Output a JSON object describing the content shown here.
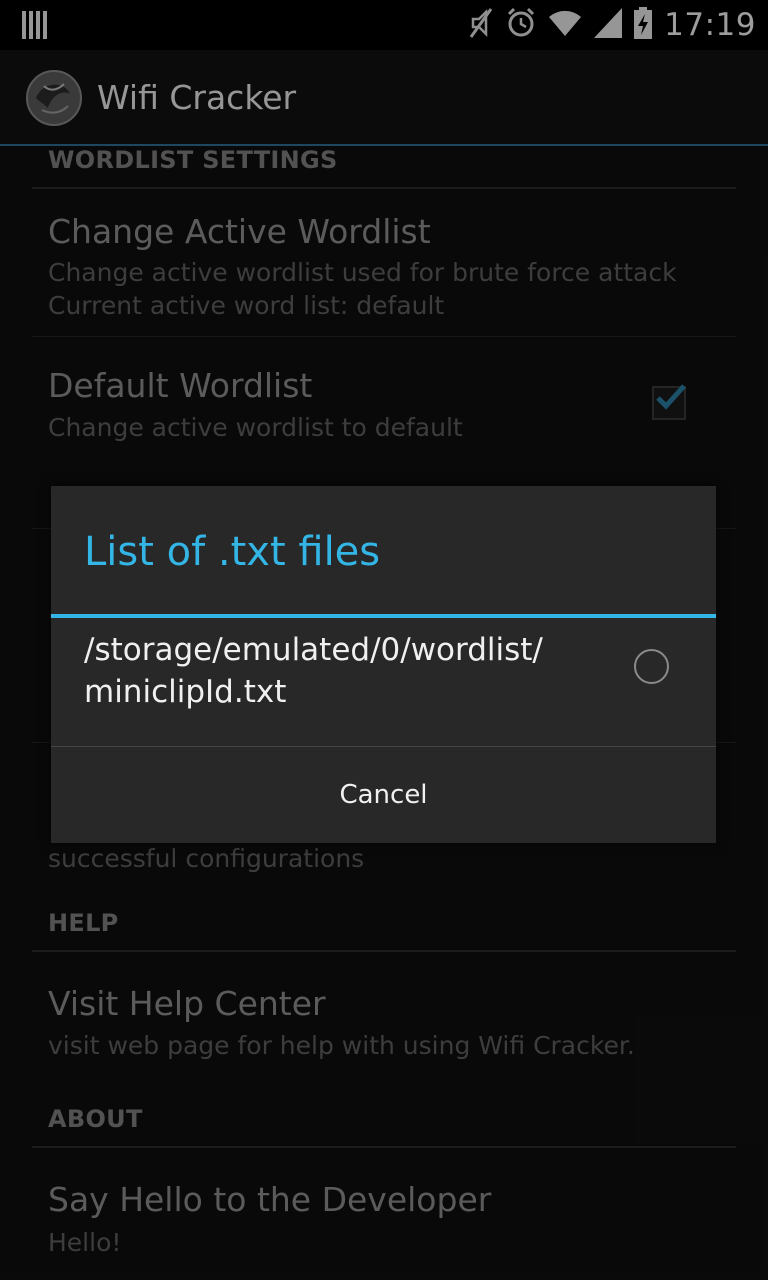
{
  "status_bar": {
    "time": "17:19",
    "icons": [
      "notification-bars-icon",
      "mute-icon",
      "alarm-icon",
      "wifi-icon",
      "signal-icon",
      "battery-charging-icon"
    ]
  },
  "action_bar": {
    "title": "Wifi Cracker",
    "icon": "app-logo-icon"
  },
  "settings": {
    "wordlist_header": "WORDLIST SETTINGS",
    "change_wordlist": {
      "title": "Change Active Wordlist",
      "summary_line1": "Change active wordlist used for brute force attack",
      "summary_line2": "Current active word list: default"
    },
    "default_wordlist": {
      "title": "Default Wordlist",
      "summary": "Change active wordlist to default",
      "checked": true
    },
    "partial_summary": "successful configurations",
    "help_header": "HELP",
    "help_center": {
      "title": "Visit Help Center",
      "summary": "visit web page for help with using Wifi Cracker."
    },
    "about_header": "ABOUT",
    "developer": {
      "title": "Say Hello to the Developer",
      "summary": "Hello!"
    }
  },
  "dialog": {
    "title": "List of .txt files",
    "items": [
      {
        "path_line1": "/storage/emulated/0/wordlist/",
        "path_line2": "miniclipId.txt",
        "selected": false
      }
    ],
    "cancel_label": "Cancel"
  },
  "colors": {
    "accent": "#33b5e5",
    "background": "#0f0f0f",
    "dialog_bg": "#282828"
  }
}
